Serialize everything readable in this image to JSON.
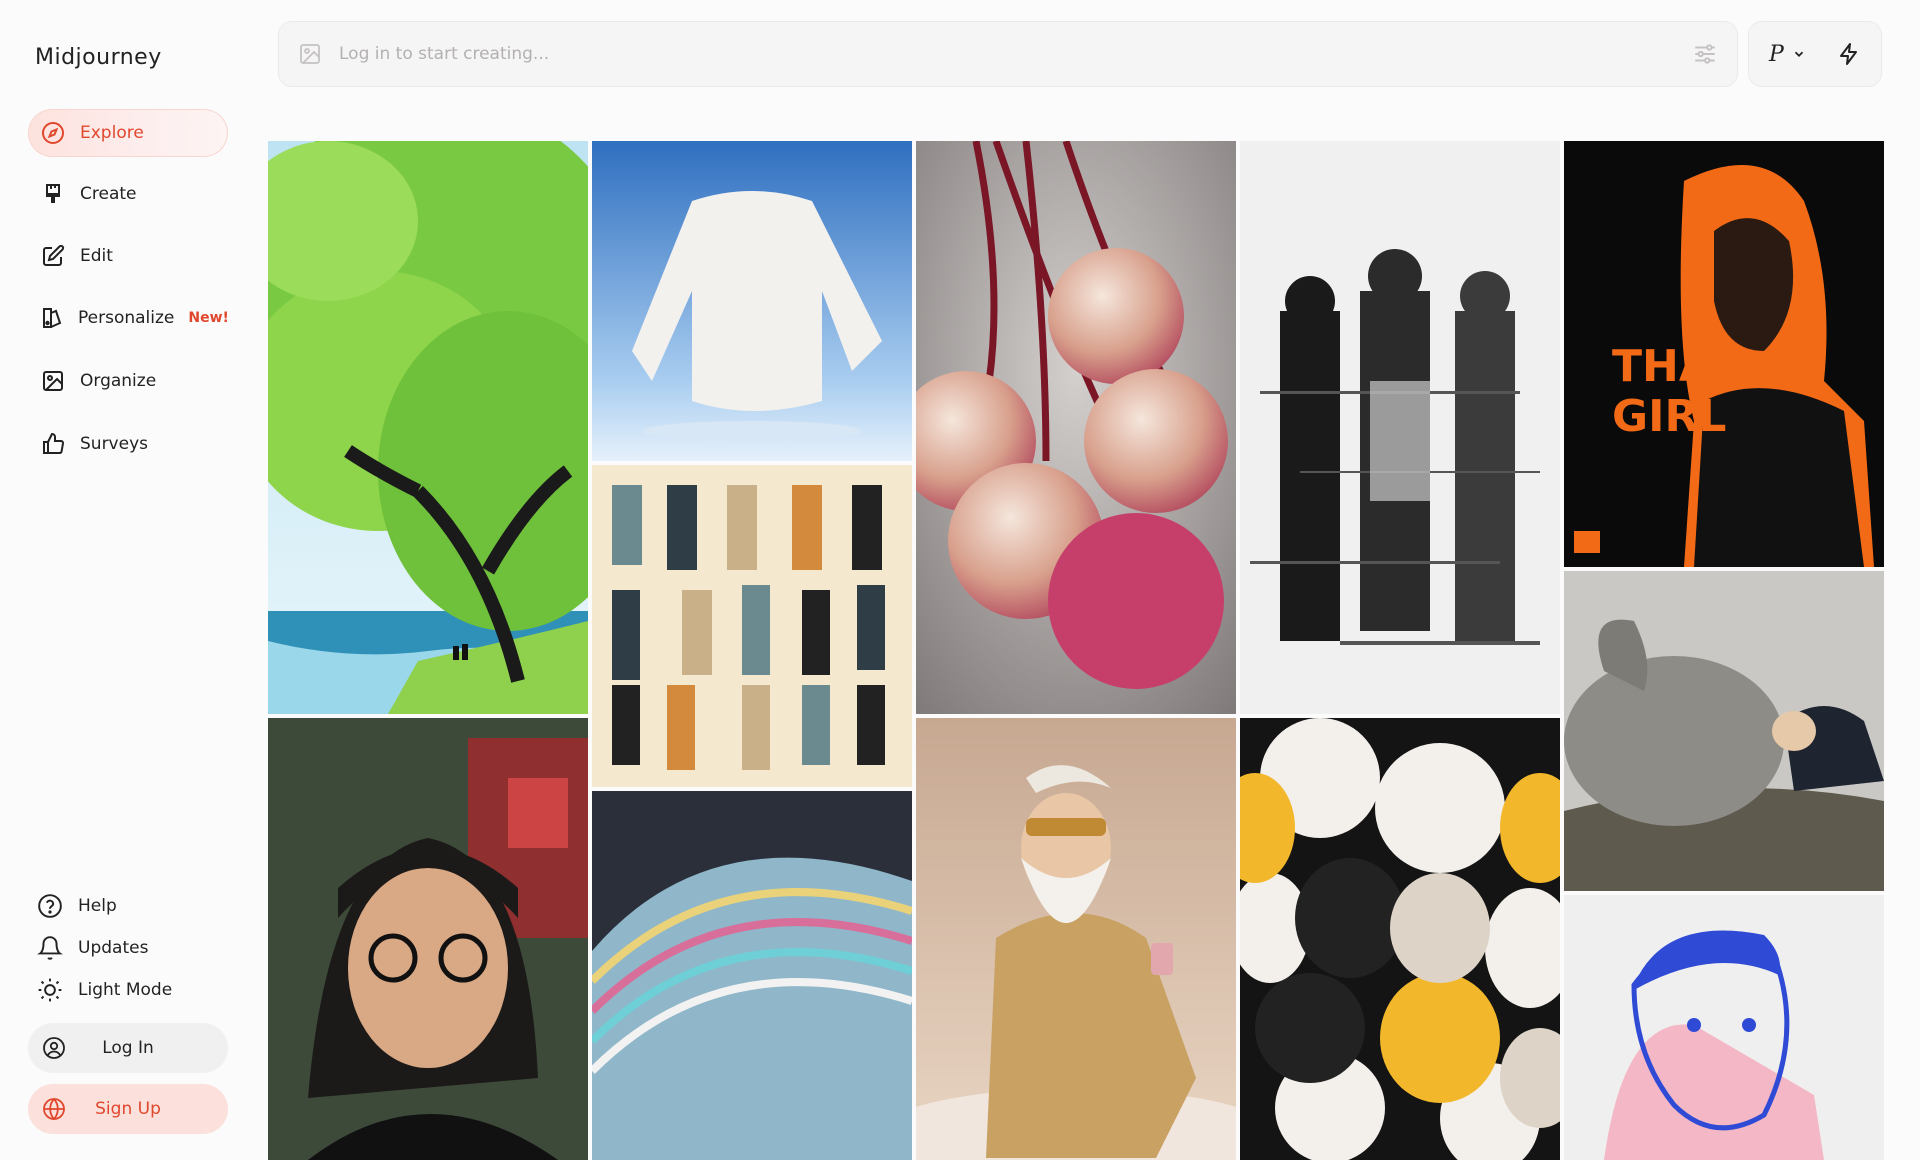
{
  "app": {
    "name": "Midjourney"
  },
  "nav": {
    "items": [
      {
        "key": "explore",
        "label": "Explore",
        "icon": "compass-icon",
        "active": true
      },
      {
        "key": "create",
        "label": "Create",
        "icon": "brush-icon"
      },
      {
        "key": "edit",
        "label": "Edit",
        "icon": "edit-icon"
      },
      {
        "key": "personalize",
        "label": "Personalize",
        "icon": "personalize-icon",
        "badge": "New!"
      },
      {
        "key": "organize",
        "label": "Organize",
        "icon": "image-icon"
      },
      {
        "key": "surveys",
        "label": "Surveys",
        "icon": "thumbs-up-icon"
      }
    ]
  },
  "footer": {
    "help": "Help",
    "updates": "Updates",
    "light_mode": "Light Mode",
    "login": "Log In",
    "signup": "Sign Up"
  },
  "prompt": {
    "placeholder": "Log in to start creating..."
  },
  "mode": {
    "letter": "P"
  },
  "colors": {
    "accent": "#e0472d",
    "active_bg": "#fde2dd",
    "signup_bg": "#fbe0db"
  },
  "gallery": {
    "images": [
      {
        "name": "tree-lake-illustration"
      },
      {
        "name": "floating-sweater"
      },
      {
        "name": "glass-cherries"
      },
      {
        "name": "glitch-men-walking"
      },
      {
        "name": "that-girl-poster",
        "text": [
          "THAT",
          "GIRL"
        ]
      },
      {
        "name": "victorian-fashion-plate"
      },
      {
        "name": "giant-rabbit"
      },
      {
        "name": "girl-with-glasses"
      },
      {
        "name": "golden-santa-clouds"
      },
      {
        "name": "cute-cats-pattern"
      },
      {
        "name": "blue-pencil-portrait"
      },
      {
        "name": "iridescent-shell"
      }
    ]
  }
}
